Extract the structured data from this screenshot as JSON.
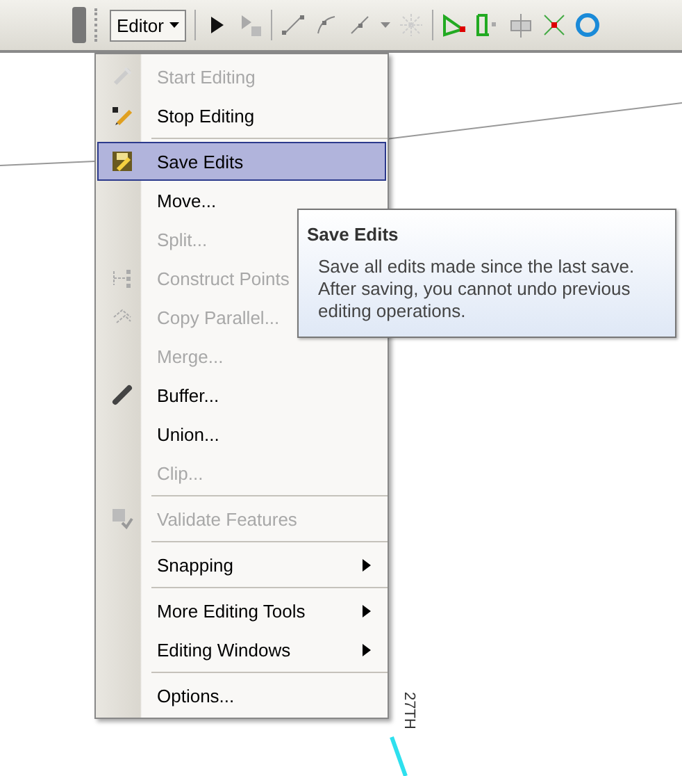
{
  "toolbar": {
    "editor_menu": {
      "label": "Editor",
      "expanded": true
    }
  },
  "menu": {
    "items": [
      {
        "label": "Start Editing",
        "disabled": true,
        "selected": false,
        "submenu": false,
        "separator_before": false
      },
      {
        "label": "Stop Editing",
        "disabled": false,
        "selected": false,
        "submenu": false,
        "separator_before": false
      },
      {
        "label": "Save Edits",
        "disabled": false,
        "selected": true,
        "submenu": false,
        "separator_before": true
      },
      {
        "label": "Move...",
        "disabled": false,
        "selected": false,
        "submenu": false,
        "separator_before": false
      },
      {
        "label": "Split...",
        "disabled": true,
        "selected": false,
        "submenu": false,
        "separator_before": false
      },
      {
        "label": "Construct Points",
        "disabled": true,
        "selected": false,
        "submenu": false,
        "separator_before": false
      },
      {
        "label": "Copy Parallel...",
        "disabled": true,
        "selected": false,
        "submenu": false,
        "separator_before": false
      },
      {
        "label": "Merge...",
        "disabled": true,
        "selected": false,
        "submenu": false,
        "separator_before": false
      },
      {
        "label": "Buffer...",
        "disabled": false,
        "selected": false,
        "submenu": false,
        "separator_before": false
      },
      {
        "label": "Union...",
        "disabled": false,
        "selected": false,
        "submenu": false,
        "separator_before": false
      },
      {
        "label": "Clip...",
        "disabled": true,
        "selected": false,
        "submenu": false,
        "separator_before": false
      },
      {
        "label": "Validate Features",
        "disabled": true,
        "selected": false,
        "submenu": false,
        "separator_before": true
      },
      {
        "label": "Snapping",
        "disabled": false,
        "selected": false,
        "submenu": true,
        "separator_before": true
      },
      {
        "label": "More Editing Tools",
        "disabled": false,
        "selected": false,
        "submenu": true,
        "separator_before": true
      },
      {
        "label": "Editing Windows",
        "disabled": false,
        "selected": false,
        "submenu": true,
        "separator_before": false
      },
      {
        "label": "Options...",
        "disabled": false,
        "selected": false,
        "submenu": false,
        "separator_before": true
      }
    ]
  },
  "tooltip": {
    "title": "Save Edits",
    "text": "Save all edits made since the last save. After saving, you cannot undo previous editing operations."
  },
  "map": {
    "street_label": "27TH"
  }
}
